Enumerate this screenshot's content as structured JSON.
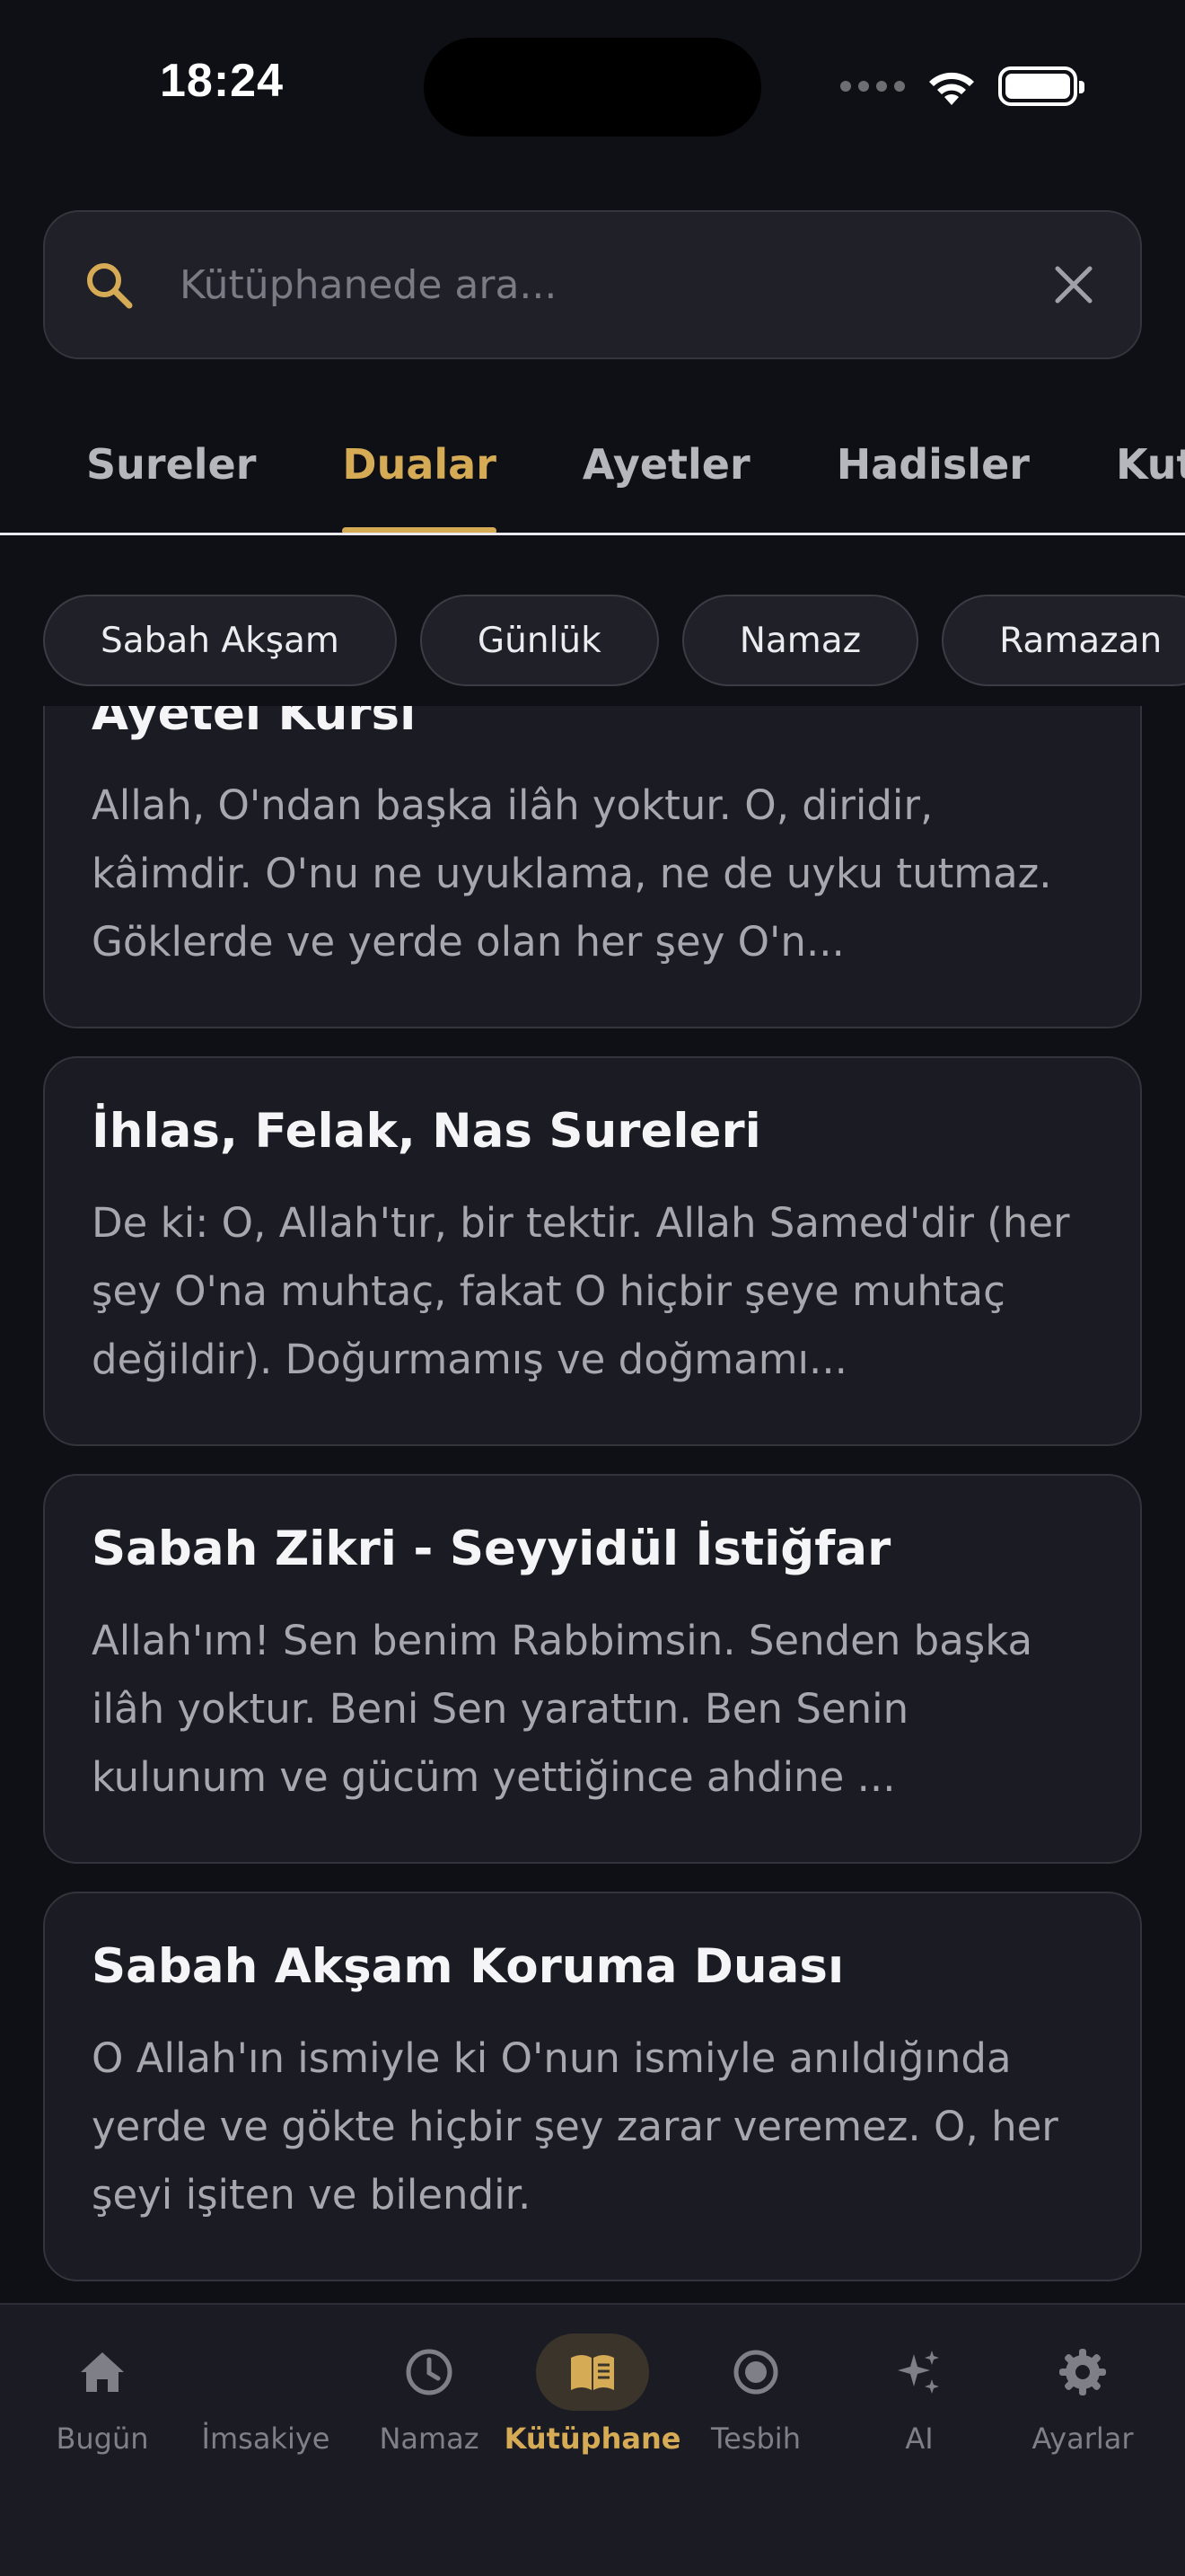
{
  "status_bar": {
    "time": "18:24"
  },
  "search": {
    "placeholder": "Kütüphanede ara..."
  },
  "tabs": [
    {
      "label": "Sureler",
      "active": false
    },
    {
      "label": "Dualar",
      "active": true
    },
    {
      "label": "Ayetler",
      "active": false
    },
    {
      "label": "Hadisler",
      "active": false
    },
    {
      "label": "Kutsal",
      "active": false
    }
  ],
  "chips": [
    "Sabah Akşam",
    "Günlük",
    "Namaz",
    "Ramazan"
  ],
  "cards": [
    {
      "title": "Ayetel Kürsi",
      "text": "Allah, O'ndan başka ilâh yoktur. O, diridir, kâimdir. O'nu ne uyuklama, ne de uyku tutmaz. Göklerde ve yerde olan her şey O'n..."
    },
    {
      "title": "İhlas, Felak, Nas Sureleri",
      "text": "De ki: O, Allah'tır, bir tektir. Allah Samed'dir (her şey O'na muhtaç, fakat O hiçbir şeye muhtaç değildir). Doğurmamış ve doğmamı..."
    },
    {
      "title": "Sabah Zikri - Seyyidül İstiğfar",
      "text": "Allah'ım! Sen benim Rabbimsin. Senden başka ilâh yoktur. Beni Sen yarattın. Ben Senin kulunum ve gücüm yettiğince ahdine ..."
    },
    {
      "title": "Sabah Akşam Koruma Duası",
      "text": "O Allah'ın ismiyle ki O'nun ismiyle anıldığında yerde ve gökte hiçbir şey zarar veremez. O, her şeyi işiten ve bilendir."
    }
  ],
  "tab_bar": [
    {
      "label": "Bugün",
      "icon": "home-icon",
      "active": false
    },
    {
      "label": "İmsakiye",
      "icon": "moon-icon",
      "active": false
    },
    {
      "label": "Namaz",
      "icon": "clock-icon",
      "active": false
    },
    {
      "label": "Kütüphane",
      "icon": "book-icon",
      "active": true
    },
    {
      "label": "Tesbih",
      "icon": "circle-icon",
      "active": false
    },
    {
      "label": "AI",
      "icon": "sparkles-icon",
      "active": false
    },
    {
      "label": "Ayarlar",
      "icon": "gear-icon",
      "active": false
    }
  ],
  "colors": {
    "accent": "#d6ab56",
    "background": "#0f1015",
    "card": "#1b1c23"
  }
}
